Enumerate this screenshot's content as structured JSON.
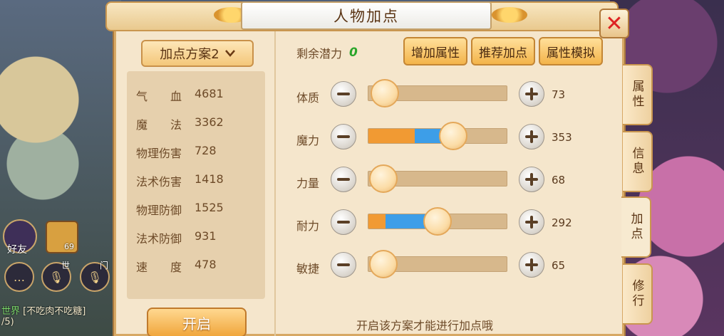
{
  "hud": {
    "friends_label": "好友",
    "pet_level": "69",
    "voice_world": "世",
    "voice_team": "门",
    "chat_channel": "世界",
    "chat_message": "[不吃肉不吃糖]",
    "chat_more": "/5)"
  },
  "panel": {
    "title": "人物加点",
    "scheme_label": "加点方案2",
    "stats": [
      {
        "label": "气　　血",
        "value": "4681"
      },
      {
        "label": "魔　　法",
        "value": "3362"
      },
      {
        "label": "物理伤害",
        "value": "728"
      },
      {
        "label": "法术伤害",
        "value": "1418"
      },
      {
        "label": "物理防御",
        "value": "1525"
      },
      {
        "label": "法术防御",
        "value": "931"
      },
      {
        "label": "速　　度",
        "value": "478"
      }
    ],
    "open_button": "开启",
    "potential_label": "剩余潜力",
    "potential_value": "0",
    "buttons": {
      "add_attr": "增加属性",
      "recommend": "推荐加点",
      "simulate": "属性模拟"
    },
    "attributes": [
      {
        "name": "体质",
        "value": "73",
        "base_fraction": 0.0,
        "add_fraction": 0.0,
        "knob_fraction": 0.12
      },
      {
        "name": "魔力",
        "value": "353",
        "base_fraction": 0.33,
        "add_fraction": 0.61,
        "knob_fraction": 0.61
      },
      {
        "name": "力量",
        "value": "68",
        "base_fraction": 0.0,
        "add_fraction": 0.0,
        "knob_fraction": 0.11
      },
      {
        "name": "耐力",
        "value": "292",
        "base_fraction": 0.12,
        "add_fraction": 0.5,
        "knob_fraction": 0.5
      },
      {
        "name": "敏捷",
        "value": "65",
        "base_fraction": 0.0,
        "add_fraction": 0.0,
        "knob_fraction": 0.11
      }
    ],
    "hint": "开启该方案才能进行加点哦",
    "tabs": [
      "属性",
      "信息",
      "加点",
      "修行"
    ],
    "active_tab": "加点"
  }
}
